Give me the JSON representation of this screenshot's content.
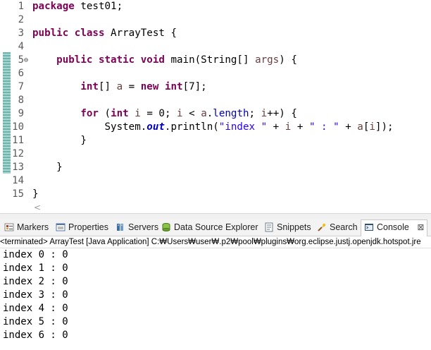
{
  "editor": {
    "lines": [
      {
        "n": "1",
        "fold": "",
        "tokens": [
          [
            "kw",
            "package"
          ],
          [
            "t",
            " test01;"
          ]
        ]
      },
      {
        "n": "2",
        "fold": "",
        "tokens": []
      },
      {
        "n": "3",
        "fold": "",
        "tokens": [
          [
            "kw",
            "public"
          ],
          [
            "t",
            " "
          ],
          [
            "kw",
            "class"
          ],
          [
            "t",
            " ArrayTest {"
          ]
        ]
      },
      {
        "n": "4",
        "fold": "",
        "tokens": []
      },
      {
        "n": "5",
        "fold": "⊖",
        "tokens": [
          [
            "t",
            "    "
          ],
          [
            "kw",
            "public"
          ],
          [
            "t",
            " "
          ],
          [
            "kw",
            "static"
          ],
          [
            "t",
            " "
          ],
          [
            "kw",
            "void"
          ],
          [
            "t",
            " main(String[] "
          ],
          [
            "var",
            "args"
          ],
          [
            "t",
            ") {"
          ]
        ]
      },
      {
        "n": "6",
        "fold": "",
        "tokens": []
      },
      {
        "n": "7",
        "fold": "",
        "tokens": [
          [
            "t",
            "        "
          ],
          [
            "kw",
            "int"
          ],
          [
            "t",
            "[] "
          ],
          [
            "var",
            "a"
          ],
          [
            "t",
            " = "
          ],
          [
            "kw",
            "new"
          ],
          [
            "t",
            " "
          ],
          [
            "kw",
            "int"
          ],
          [
            "t",
            "[7];"
          ]
        ]
      },
      {
        "n": "8",
        "fold": "",
        "tokens": []
      },
      {
        "n": "9",
        "fold": "",
        "tokens": [
          [
            "t",
            "        "
          ],
          [
            "kw",
            "for"
          ],
          [
            "t",
            " ("
          ],
          [
            "kw",
            "int"
          ],
          [
            "t",
            " "
          ],
          [
            "var",
            "i"
          ],
          [
            "t",
            " = 0; "
          ],
          [
            "var",
            "i"
          ],
          [
            "t",
            " < "
          ],
          [
            "var",
            "a"
          ],
          [
            "t",
            "."
          ],
          [
            "fld",
            "length"
          ],
          [
            "t",
            "; "
          ],
          [
            "var",
            "i"
          ],
          [
            "t",
            "++) {"
          ]
        ]
      },
      {
        "n": "10",
        "fold": "",
        "tokens": [
          [
            "t",
            "            System."
          ],
          [
            "sfld",
            "out"
          ],
          [
            "t",
            ".println("
          ],
          [
            "str",
            "\"index \""
          ],
          [
            "t",
            " + "
          ],
          [
            "var",
            "i"
          ],
          [
            "t",
            " + "
          ],
          [
            "str",
            "\" : \""
          ],
          [
            "t",
            " + "
          ],
          [
            "var",
            "a"
          ],
          [
            "t",
            "["
          ],
          [
            "var",
            "i"
          ],
          [
            "t",
            "]);"
          ]
        ]
      },
      {
        "n": "11",
        "fold": "",
        "tokens": [
          [
            "t",
            "        }"
          ]
        ]
      },
      {
        "n": "12",
        "fold": "",
        "tokens": []
      },
      {
        "n": "13",
        "fold": "",
        "tokens": [
          [
            "t",
            "    }"
          ]
        ]
      },
      {
        "n": "14",
        "fold": "",
        "tokens": []
      },
      {
        "n": "15",
        "fold": "",
        "tokens": [
          [
            "t",
            "}"
          ]
        ]
      }
    ],
    "hscroll_arrow": "<"
  },
  "tabs": [
    {
      "label": "Markers",
      "icon": "markers-icon",
      "color": "#c0392b",
      "active": false
    },
    {
      "label": "Properties",
      "icon": "properties-icon",
      "color": "#5577aa",
      "active": false
    },
    {
      "label": "Servers",
      "icon": "servers-icon",
      "color": "#3b6ea8",
      "active": false
    },
    {
      "label": "Data Source Explorer",
      "icon": "database-icon",
      "color": "#5a9a2e",
      "active": false
    },
    {
      "label": "Snippets",
      "icon": "snippets-icon",
      "color": "#6b7b8c",
      "active": false
    },
    {
      "label": "Search",
      "icon": "search-icon",
      "color": "#d9a520",
      "active": false
    },
    {
      "label": "Console",
      "icon": "console-icon",
      "color": "#2f4f6f",
      "active": true
    }
  ],
  "console": {
    "close_glyph": "⊠",
    "status": "<terminated> ArrayTest [Java Application] C:₩Users₩user₩.p2₩pool₩plugins₩org.eclipse.justj.openjdk.hotspot.jre",
    "output": [
      "index 0 : 0",
      "index 1 : 0",
      "index 2 : 0",
      "index 3 : 0",
      "index 4 : 0",
      "index 5 : 0",
      "index 6 : 0"
    ]
  }
}
